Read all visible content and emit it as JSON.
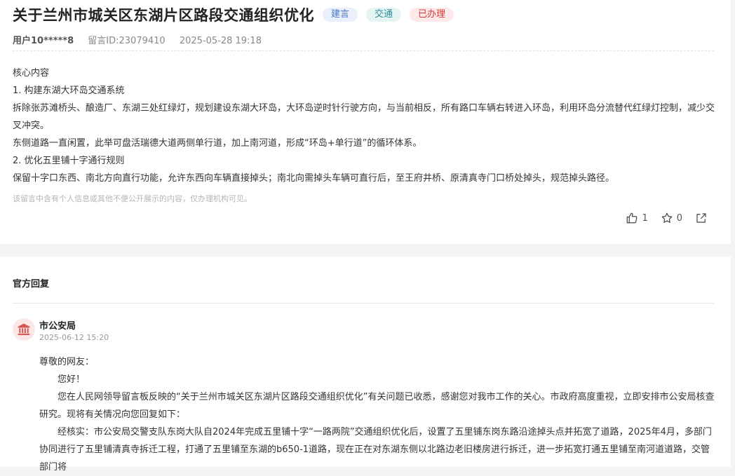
{
  "post": {
    "title": "关于兰州市城关区东湖片区路段交通组织优化",
    "tags": [
      "建言",
      "交通",
      "已办理"
    ],
    "user": "用户10*****8",
    "message_id": "留言ID:23079410",
    "datetime": "2025-05-28 19:18",
    "content": [
      "核心内容",
      "1. 构建东湖大环岛交通系统",
      "拆除张苏滩桥头、酿造厂、东湖三处红绿灯，规划建设东湖大环岛，大环岛逆时针行驶方向，与当前相反，所有路口车辆右转进入环岛，利用环岛分流替代红绿灯控制，减少交叉冲突。",
      "东侧道路一直闲置，此举可盘活瑞德大道两侧单行道，加上南河道，形成“环岛+单行道”的循环体系。",
      "2. 优化五里铺十字通行规则",
      "保留十字口东西、南北方向直行功能，允许东西向车辆直接掉头；南北向需掉头车辆可直行后，至王府井桥、原清真寺门口桥处掉头，规范掉头路径。"
    ],
    "privacy_notice": "该留言中含有个人信息或其他不便公开展示的内容，仅办理机构可见。",
    "likes": "1",
    "favorites": "0"
  },
  "reply": {
    "heading": "官方回复",
    "department": "市公安局",
    "datetime": "2025-06-12 15:20",
    "greeting": "尊敬的网友：",
    "hello": "您好！",
    "paragraphs": [
      "您在人民网领导留言板反映的“关于兰州市城关区东湖片区路段交通组织优化”有关问题已收悉，感谢您对我市工作的关心。市政府高度重视，立即安排市公安局核查研究。现将有关情况向您回复如下：",
      "经核实：市公安局交警支队东岗大队自2024年完成五里铺十字“一路两院”交通组织优化后，设置了五里铺东岗东路沿途掉头点并拓宽了道路，2025年4月，多部门协同进行了五里铺清真寺拆迁工程，打通了五里铺至东湖的b650-1道路，现在正在对东湖东侧以北路边老旧楼房进行拆迁，进一步拓宽打通五里铺至南河道道路，交管部门将"
    ]
  },
  "icons": {
    "like": "thumbs-up-icon",
    "favorite": "star-icon",
    "share": "share-icon",
    "avatar": "government-building-icon"
  },
  "colors": {
    "tag_blue": "#4a78c2",
    "tag_teal": "#2f8f9e",
    "tag_red": "#d83b3b",
    "avatar_bg": "#fbe7e6",
    "avatar_icon": "#d9534f"
  }
}
